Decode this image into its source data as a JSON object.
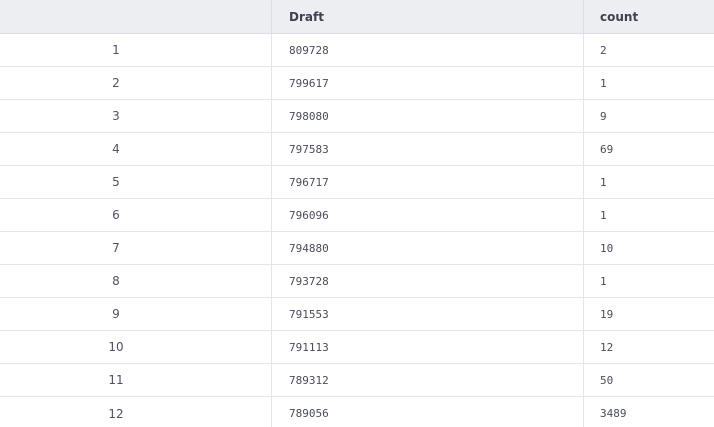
{
  "table": {
    "columns": [
      "",
      "Draft",
      "count"
    ],
    "rows": [
      {
        "index": "1",
        "draft": "809728",
        "count": "2"
      },
      {
        "index": "2",
        "draft": "799617",
        "count": "1"
      },
      {
        "index": "3",
        "draft": "798080",
        "count": "9"
      },
      {
        "index": "4",
        "draft": "797583",
        "count": "69"
      },
      {
        "index": "5",
        "draft": "796717",
        "count": "1"
      },
      {
        "index": "6",
        "draft": "796096",
        "count": "1"
      },
      {
        "index": "7",
        "draft": "794880",
        "count": "10"
      },
      {
        "index": "8",
        "draft": "793728",
        "count": "1"
      },
      {
        "index": "9",
        "draft": "791553",
        "count": "19"
      },
      {
        "index": "10",
        "draft": "791113",
        "count": "12"
      },
      {
        "index": "11",
        "draft": "789312",
        "count": "50"
      },
      {
        "index": "12",
        "draft": "789056",
        "count": "3489"
      }
    ]
  }
}
